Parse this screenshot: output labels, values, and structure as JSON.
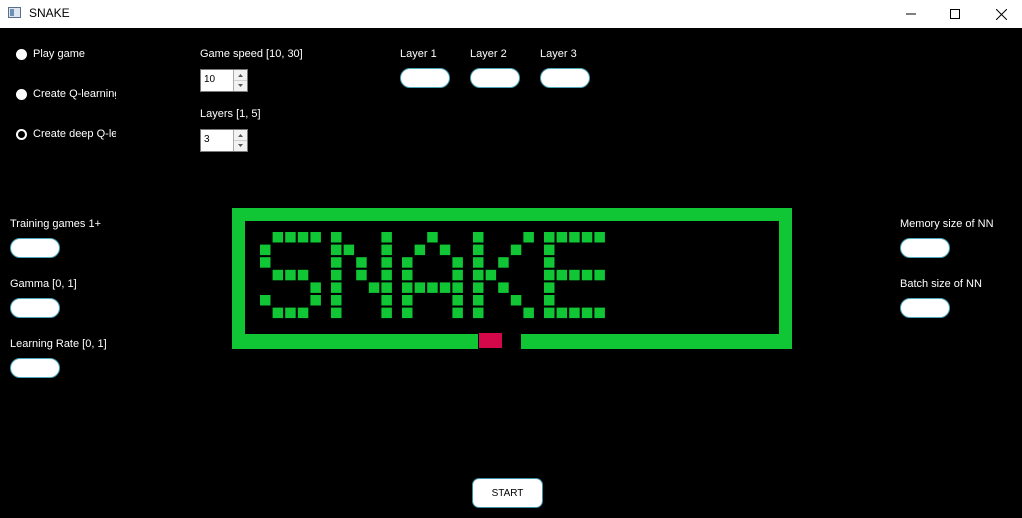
{
  "window": {
    "title": "SNAKE",
    "controls": [
      "minimize",
      "maximize",
      "close"
    ]
  },
  "mode": {
    "options": [
      {
        "label": "Play game",
        "checked": false
      },
      {
        "label": "Create Q-learning",
        "checked": false
      },
      {
        "label": "Create deep Q-le",
        "checked": true
      }
    ]
  },
  "settings": {
    "game_speed_label": "Game speed [10, 30]",
    "game_speed_value": "10",
    "layers_label": "Layers [1, 5]",
    "layers_value": "3"
  },
  "layers": {
    "layer1_label": "Layer 1",
    "layer2_label": "Layer 2",
    "layer3_label": "Layer 3"
  },
  "training": {
    "games_label": "Training games 1+",
    "gamma_label": "Gamma [0, 1]",
    "lr_label": "Learning Rate [0, 1]"
  },
  "network": {
    "memory_label": "Memory size of NN",
    "batch_label": "Batch size of NN"
  },
  "logo": {
    "text": "SNAKE",
    "border_color": "#11c634",
    "cell_color": "#11c634",
    "food_color": "#d2084a"
  },
  "start": {
    "label": "START"
  }
}
